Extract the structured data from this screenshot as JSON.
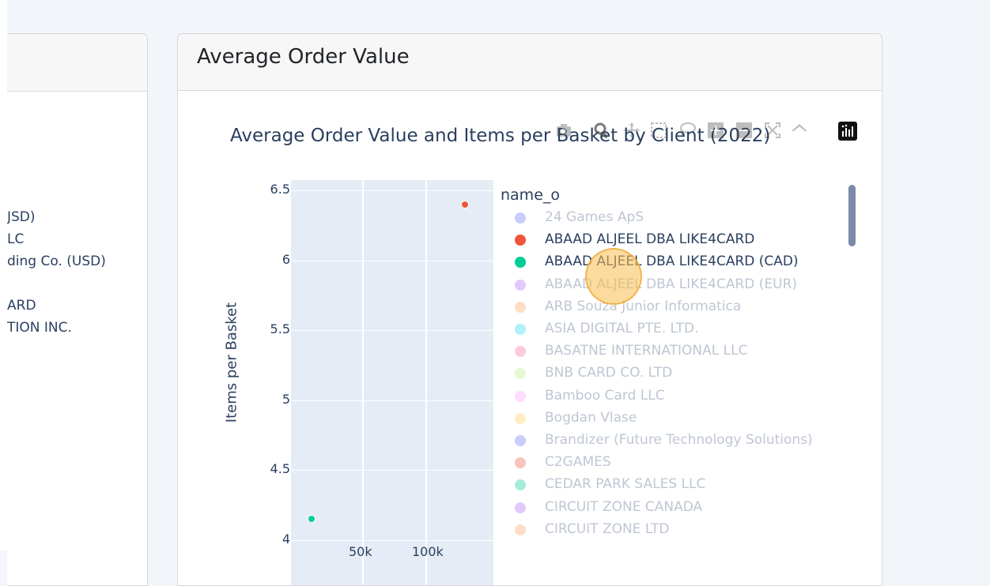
{
  "left_card": {
    "partial_items": [
      "JSD)",
      "LC",
      "ding Co. (USD)",
      "ARD",
      "TION INC."
    ]
  },
  "main_card": {
    "title": "Average Order Value"
  },
  "chart_data": {
    "type": "scatter",
    "title": "Average Order Value and Items per Basket by Client (2022)",
    "xlabel": "",
    "ylabel": "Items per Basket",
    "y_ticks": [
      "4",
      "4.5",
      "5",
      "5.5",
      "6",
      "6.5"
    ],
    "x_ticks": [
      "50k",
      "100k"
    ],
    "ylim": [
      4,
      6.6
    ],
    "xlim": [
      0,
      143000
    ],
    "grid": true,
    "legend": {
      "title": "name_o",
      "placement": "right",
      "entries": [
        {
          "name": "24 Games ApS",
          "color": "#636efa",
          "active": false
        },
        {
          "name": "ABAAD ALJEEL DBA LIKE4CARD",
          "color": "#ef553b",
          "active": true
        },
        {
          "name": "ABAAD ALJEEL DBA LIKE4CARD (CAD)",
          "color": "#00cc96",
          "active": true
        },
        {
          "name": "ABAAD ALJEEL DBA LIKE4CARD (EUR)",
          "color": "#ab63fa",
          "active": false
        },
        {
          "name": "ARB Souza Junior Informatica",
          "color": "#ffa15a",
          "active": false
        },
        {
          "name": "ASIA DIGITAL PTE. LTD.",
          "color": "#19d3f3",
          "active": false
        },
        {
          "name": "BASATNE INTERNATIONAL LLC",
          "color": "#ff6692",
          "active": false
        },
        {
          "name": "BNB CARD CO. LTD",
          "color": "#b6e880",
          "active": false
        },
        {
          "name": "Bamboo Card LLC",
          "color": "#ff97ff",
          "active": false
        },
        {
          "name": "Bogdan Vlase",
          "color": "#fecb52",
          "active": false
        },
        {
          "name": "Brandizer (Future Technology Solutions)",
          "color": "#636efa",
          "active": false
        },
        {
          "name": "C2GAMES",
          "color": "#ef553b",
          "active": false
        },
        {
          "name": "CEDAR PARK SALES LLC",
          "color": "#00cc96",
          "active": false
        },
        {
          "name": "CIRCUIT ZONE CANADA",
          "color": "#ab63fa",
          "active": false
        },
        {
          "name": "CIRCUIT ZONE LTD",
          "color": "#ffa15a",
          "active": false
        }
      ]
    },
    "series": [
      {
        "name": "ABAAD ALJEEL DBA LIKE4CARD",
        "color": "#ef553b",
        "points": [
          {
            "x": 131000,
            "y": 6.4
          }
        ]
      },
      {
        "name": "ABAAD ALJEEL DBA LIKE4CARD (CAD)",
        "color": "#00cc96",
        "points": [
          {
            "x": 10000,
            "y": 4.15
          }
        ]
      }
    ]
  },
  "modebar": {
    "buttons": [
      "camera-icon",
      "zoom-icon",
      "pan-icon",
      "box-select-icon",
      "lasso-icon",
      "zoom-in-icon",
      "zoom-out-icon",
      "autoscale-icon",
      "reset-axes-icon"
    ],
    "logo": "plotly-logo-icon"
  }
}
